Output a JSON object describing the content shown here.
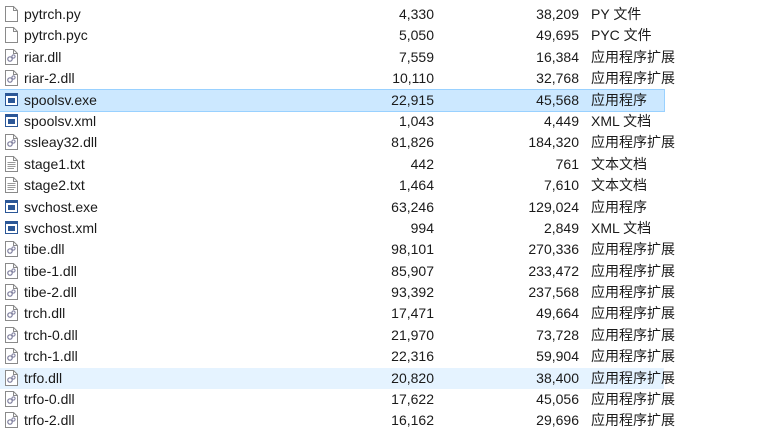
{
  "files": [
    {
      "name": "pytrch.py",
      "size": "4,330",
      "packed": "38,209",
      "type": "PY 文件",
      "icon": "file-icon",
      "state": ""
    },
    {
      "name": "pytrch.pyc",
      "size": "5,050",
      "packed": "49,695",
      "type": "PYC 文件",
      "icon": "file-icon",
      "state": ""
    },
    {
      "name": "riar.dll",
      "size": "7,559",
      "packed": "16,384",
      "type": "应用程序扩展",
      "icon": "dll-icon",
      "state": ""
    },
    {
      "name": "riar-2.dll",
      "size": "10,110",
      "packed": "32,768",
      "type": "应用程序扩展",
      "icon": "dll-icon",
      "state": ""
    },
    {
      "name": "spoolsv.exe",
      "size": "22,915",
      "packed": "45,568",
      "type": "应用程序",
      "icon": "exe-icon",
      "state": "selected"
    },
    {
      "name": "spoolsv.xml",
      "size": "1,043",
      "packed": "4,449",
      "type": "XML 文档",
      "icon": "xml-icon",
      "state": ""
    },
    {
      "name": "ssleay32.dll",
      "size": "81,826",
      "packed": "184,320",
      "type": "应用程序扩展",
      "icon": "dll-icon",
      "state": ""
    },
    {
      "name": "stage1.txt",
      "size": "442",
      "packed": "761",
      "type": "文本文档",
      "icon": "text-file-icon",
      "state": ""
    },
    {
      "name": "stage2.txt",
      "size": "1,464",
      "packed": "7,610",
      "type": "文本文档",
      "icon": "text-file-icon",
      "state": ""
    },
    {
      "name": "svchost.exe",
      "size": "63,246",
      "packed": "129,024",
      "type": "应用程序",
      "icon": "exe-icon",
      "state": ""
    },
    {
      "name": "svchost.xml",
      "size": "994",
      "packed": "2,849",
      "type": "XML 文档",
      "icon": "xml-icon",
      "state": ""
    },
    {
      "name": "tibe.dll",
      "size": "98,101",
      "packed": "270,336",
      "type": "应用程序扩展",
      "icon": "dll-icon",
      "state": ""
    },
    {
      "name": "tibe-1.dll",
      "size": "85,907",
      "packed": "233,472",
      "type": "应用程序扩展",
      "icon": "dll-icon",
      "state": ""
    },
    {
      "name": "tibe-2.dll",
      "size": "93,392",
      "packed": "237,568",
      "type": "应用程序扩展",
      "icon": "dll-icon",
      "state": ""
    },
    {
      "name": "trch.dll",
      "size": "17,471",
      "packed": "49,664",
      "type": "应用程序扩展",
      "icon": "dll-icon",
      "state": ""
    },
    {
      "name": "trch-0.dll",
      "size": "21,970",
      "packed": "73,728",
      "type": "应用程序扩展",
      "icon": "dll-icon",
      "state": ""
    },
    {
      "name": "trch-1.dll",
      "size": "22,316",
      "packed": "59,904",
      "type": "应用程序扩展",
      "icon": "dll-icon",
      "state": ""
    },
    {
      "name": "trfo.dll",
      "size": "20,820",
      "packed": "38,400",
      "type": "应用程序扩展",
      "icon": "dll-icon",
      "state": "hover"
    },
    {
      "name": "trfo-0.dll",
      "size": "17,622",
      "packed": "45,056",
      "type": "应用程序扩展",
      "icon": "dll-icon",
      "state": ""
    },
    {
      "name": "trfo-2.dll",
      "size": "16,162",
      "packed": "29,696",
      "type": "应用程序扩展",
      "icon": "dll-icon",
      "state": ""
    }
  ]
}
